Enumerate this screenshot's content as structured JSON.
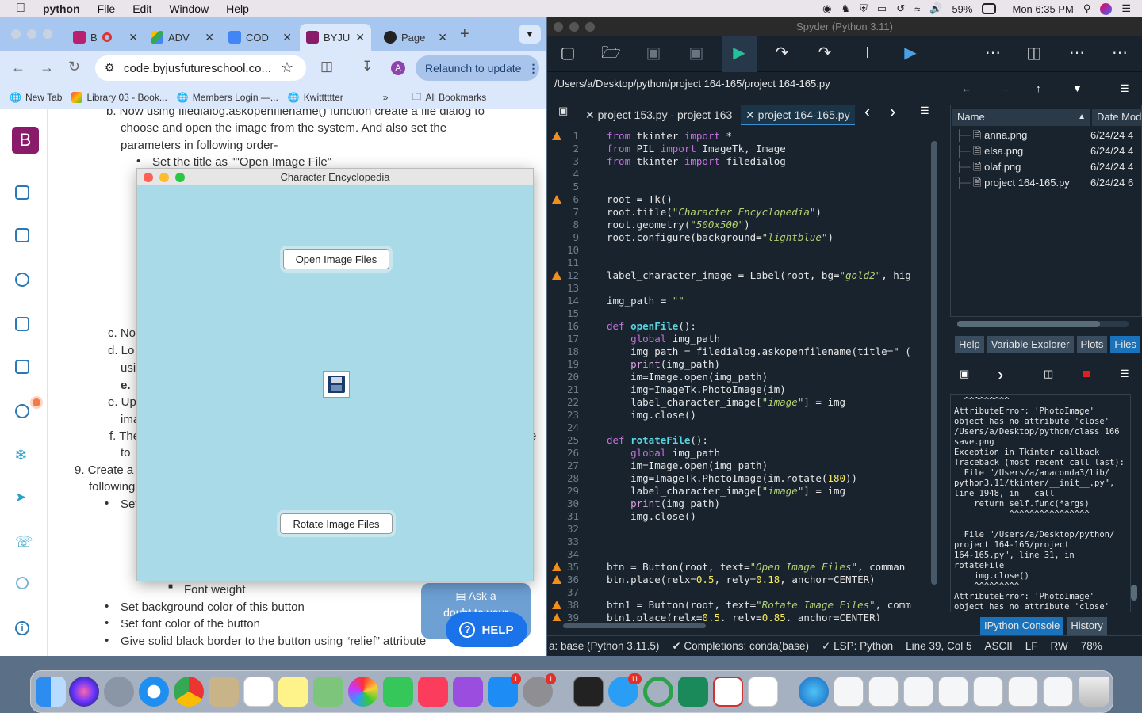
{
  "menubar": {
    "app": "python",
    "items": [
      "File",
      "Edit",
      "Window",
      "Help"
    ],
    "battery": "59%",
    "clock": "Mon 6:35 PM"
  },
  "chrome": {
    "tabs": [
      {
        "label": "B",
        "color": "#b8216f"
      },
      {
        "label": "ADV",
        "color": "#34a853"
      },
      {
        "label": "COD",
        "color": "#4285f4"
      },
      {
        "label": "BYJU",
        "color": "#8a1b6b"
      },
      {
        "label": "Page",
        "color": "#222222"
      }
    ],
    "url": "code.byjusfutureschool.co...",
    "relaunch": "Relaunch to update",
    "profile": "A",
    "bookmarks": [
      "New Tab",
      "Library 03 - Book...",
      "Members Login —...",
      "Kwitttttter"
    ],
    "all_bookmarks": "All Bookmarks"
  },
  "doc": {
    "b1": "b. Now using filedialog.askopenfilename() function create a file dialog to",
    "b2": "choose and open the image from the system. And also set the",
    "b3": "parameters in following order-",
    "b4": "Set the title as \"\"Open Image File\"",
    "c": "c. No",
    "d": "d. Lo",
    "d2": "usi",
    "d3": "e.",
    "e": "e. Up",
    "e2": "ima",
    "f": "f. The",
    "f2": "to",
    "n9": "9. Create a",
    "n9b": "following",
    "set": "Set",
    "fontweight": "Font weight",
    "bg": "Set background color of this button",
    "fg": "Set font color of the button",
    "border": "Give solid black border to the button using “relief” attribute",
    "fe": "e",
    "ask1": "Ask a",
    "ask2": "doubt to your",
    "help": "HELP"
  },
  "tk": {
    "title": "Character Encyclopedia",
    "open_btn": "Open Image Files",
    "rotate_btn": "Rotate Image Files"
  },
  "spyder": {
    "title": "Spyder (Python 3.11)",
    "path": "/Users/a/Desktop/python/project 164-165/project 164-165.py",
    "tabs": [
      "project 153.py - project 163",
      "project 164-165.py"
    ],
    "files_header": [
      "Name",
      "Date Mod"
    ],
    "files": [
      {
        "name": "anna.png",
        "date": "6/24/24 4"
      },
      {
        "name": "elsa.png",
        "date": "6/24/24 4"
      },
      {
        "name": "olaf.png",
        "date": "6/24/24 4"
      },
      {
        "name": "project 164-165.py",
        "date": "6/24/24 6"
      }
    ],
    "pane_tabs": [
      "Help",
      "Variable Explorer",
      "Plots",
      "Files"
    ],
    "console_tabs": [
      "IPython Console",
      "History"
    ],
    "console": "  ^^^^^^^^^\nAttributeError: 'PhotoImage'\nobject has no attribute 'close'\n/Users/a/Desktop/python/class 166\nsave.png\nException in Tkinter callback\nTraceback (most recent call last):\n  File \"/Users/a/anaconda3/lib/\npython3.11/tkinter/__init__.py\",\nline 1948, in __call__\n    return self.func(*args)\n           ^^^^^^^^^^^^^^^^\n\n  File \"/Users/a/Desktop/python/\nproject 164-165/project\n164-165.py\", line 31, in\nrotateFile\n    img.close()\n    ^^^^^^^^^\nAttributeError: 'PhotoImage'\nobject has no attribute 'close'",
    "status": [
      "a: base (Python 3.11.5)",
      "Completions: conda(base)",
      "LSP: Python",
      "Line 39, Col 5",
      "ASCII",
      "LF",
      "RW",
      "78%"
    ]
  },
  "code": [
    {
      "n": "1",
      "w": true
    },
    {
      "n": "2"
    },
    {
      "n": "3"
    },
    {
      "n": "4"
    },
    {
      "n": "5"
    },
    {
      "n": "6",
      "w": true
    },
    {
      "n": "7"
    },
    {
      "n": "8"
    },
    {
      "n": "9"
    },
    {
      "n": "10"
    },
    {
      "n": "11"
    },
    {
      "n": "12",
      "w": true
    },
    {
      "n": "13"
    },
    {
      "n": "14"
    },
    {
      "n": "15"
    },
    {
      "n": "16"
    },
    {
      "n": "17"
    },
    {
      "n": "18"
    },
    {
      "n": "19"
    },
    {
      "n": "20"
    },
    {
      "n": "21"
    },
    {
      "n": "22"
    },
    {
      "n": "23"
    },
    {
      "n": "24"
    },
    {
      "n": "25"
    },
    {
      "n": "26"
    },
    {
      "n": "27"
    },
    {
      "n": "28"
    },
    {
      "n": "29"
    },
    {
      "n": "30"
    },
    {
      "n": "31"
    },
    {
      "n": "32"
    },
    {
      "n": "33"
    },
    {
      "n": "34"
    },
    {
      "n": "35",
      "w": true
    },
    {
      "n": "36",
      "w": true
    },
    {
      "n": "37"
    },
    {
      "n": "38",
      "w": true
    },
    {
      "n": "39",
      "w": true
    }
  ],
  "code_text": [
    "from tkinter import *",
    "from PIL import ImageTk, Image",
    "from tkinter import filedialog",
    "",
    "",
    "root = Tk()",
    "root.title(\"Character Encyclopedia\")",
    "root.geometry(\"500x500\")",
    "root.configure(background=\"lightblue\")",
    "",
    "",
    "label_character_image = Label(root, bg=\"gold2\", hig",
    "",
    "img_path = \"\"",
    "",
    "def openFile():",
    "    global img_path",
    "    img_path = filedialog.askopenfilename(title=\" (",
    "    print(img_path)",
    "    im=Image.open(img_path)",
    "    img=ImageTk.PhotoImage(im)",
    "    label_character_image[\"image\"] = img",
    "    img.close()",
    "",
    "def rotateFile():",
    "    global img_path",
    "    im=Image.open(img_path)",
    "    img=ImageTk.PhotoImage(im.rotate(180))",
    "    label_character_image[\"image\"] = img",
    "    print(img_path)",
    "    img.close()",
    "",
    "",
    "",
    "btn = Button(root, text=\"Open Image Files\", comman",
    "btn.place(relx=0.5, rely=0.18, anchor=CENTER)",
    "",
    "btn1 = Button(root, text=\"Rotate Image Files\", comm",
    "btn1.place(relx=0.5, rely=0.85, anchor=CENTER)"
  ],
  "dock_badges": {
    "appstore": "1",
    "settings": "1",
    "messages": "11"
  }
}
